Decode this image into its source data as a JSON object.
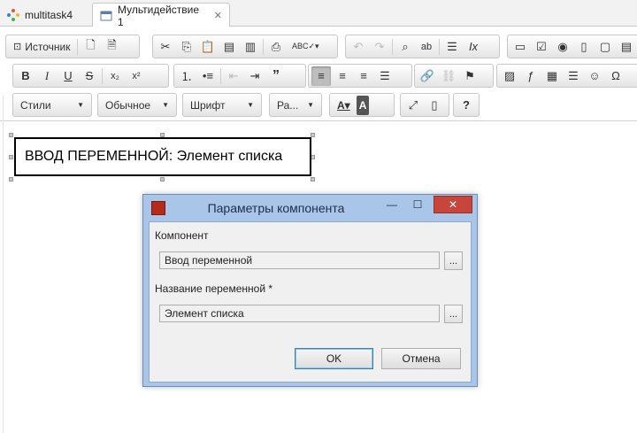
{
  "tabs": [
    {
      "label": "multitask4",
      "icon": "app-dots-icon"
    },
    {
      "label": "Мультидействие 1",
      "icon": "document-window-icon",
      "close": "✕"
    }
  ],
  "toolbar": {
    "source_label": "Источник",
    "styles_label": "Стили",
    "format_label": "Обычное",
    "font_label": "Шрифт",
    "size_label": "Ра..."
  },
  "document": {
    "field_text": "ВВОД ПЕРЕМЕННОЙ: Элемент списка"
  },
  "dialog": {
    "title": "Параметры компонента",
    "component_label": "Компонент",
    "component_value": "Ввод переменной",
    "variable_label": "Название переменной *",
    "variable_value": "Элемент списка",
    "browse_label": "...",
    "ok_label": "OK",
    "cancel_label": "Отмена",
    "close_glyph": "✕",
    "min_glyph": "—",
    "max_glyph": "☐"
  },
  "colors": {
    "dialog_frame": "#a9c5e8",
    "close_button": "#c7453b",
    "active_button": "#bdbdbd"
  }
}
